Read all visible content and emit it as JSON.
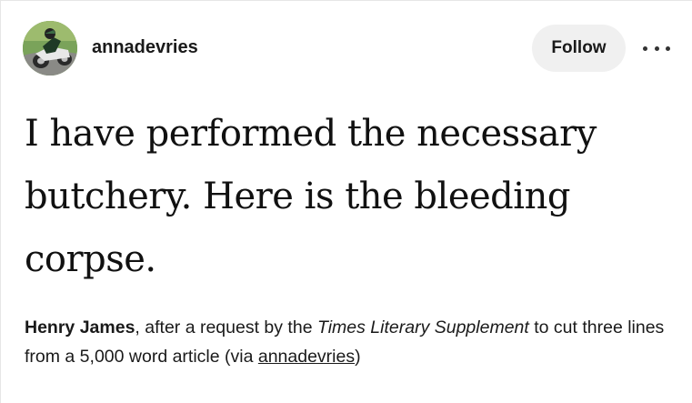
{
  "post": {
    "username": "annadevries",
    "follow_label": "Follow",
    "more_icon": "ellipsis-icon",
    "avatar_icon": "motorcycle-rider-avatar",
    "quote_text": "I have performed the necessary butchery. Here is the bleeding corpse.",
    "source": {
      "author": "Henry James",
      "text_before": ", after a request by the ",
      "publication": "Times Literary Supplement",
      "text_after": " to cut three lines from a 5,000 word article (via ",
      "via_link": "annadevries",
      "text_end": ")"
    }
  },
  "colors": {
    "follow_bg": "#f0f0f0",
    "text": "#1a1a1a",
    "border": "#e6e6e6"
  }
}
